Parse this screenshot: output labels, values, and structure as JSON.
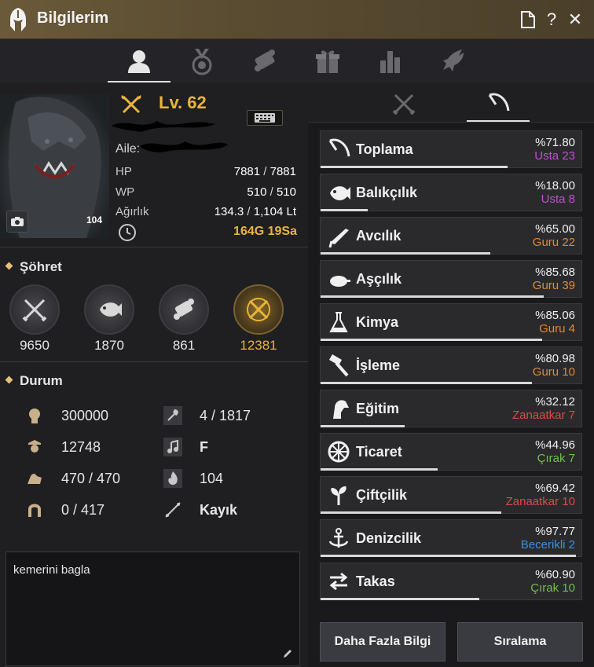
{
  "window": {
    "title": "Bilgilerim"
  },
  "titlebar_icons": [
    "document-icon",
    "help-icon",
    "close-icon"
  ],
  "main_tabs": [
    "profile-icon",
    "medal-icon",
    "scroll-icon",
    "gift-icon",
    "bar-chart-icon",
    "dragon-icon"
  ],
  "character": {
    "level_label": "Lv.",
    "level": "62",
    "aile_label": "Aile:",
    "portrait_badge": "104",
    "hp_label": "HP",
    "hp_cur": "7881",
    "hp_max": "7881",
    "wp_label": "WP",
    "wp_cur": "510",
    "wp_max": "510",
    "weight_label": "Ağırlık",
    "weight_cur": "134.3",
    "weight_max": "1,104 Lt",
    "time": "164G 19Sa"
  },
  "fame": {
    "title": "Şöhret",
    "items": [
      {
        "value": "9650",
        "icon": "crossed-swords-icon"
      },
      {
        "value": "1870",
        "icon": "fish-icon"
      },
      {
        "value": "861",
        "icon": "scroll-icon"
      },
      {
        "value": "12381",
        "icon": "crossed-swords-gold-icon"
      }
    ]
  },
  "durum": {
    "title": "Durum",
    "items": [
      {
        "icon": "knowledge-head-icon",
        "value": "300000"
      },
      {
        "icon": "axe-icon",
        "value": "4 / 1817"
      },
      {
        "icon": "officer-icon",
        "value": "12748"
      },
      {
        "icon": "music-note-icon",
        "value": "F"
      },
      {
        "icon": "strength-arm-icon",
        "value": "470 / 470"
      },
      {
        "icon": "flame-icon",
        "value": "104"
      },
      {
        "icon": "horseshoe-icon",
        "value": "0 / 417"
      },
      {
        "icon": "boat-icon",
        "value": "Kayık"
      }
    ]
  },
  "chat": {
    "text": "kemerini bagla"
  },
  "skills": [
    {
      "name": "Toplama",
      "pct": "%71.80",
      "rank": "Usta",
      "level": "23",
      "rank_color": "#c04fd0",
      "progress": 0.718,
      "icon": "sickle-icon"
    },
    {
      "name": "Balıkçılık",
      "pct": "%18.00",
      "rank": "Usta",
      "level": "8",
      "rank_color": "#c04fd0",
      "progress": 0.18,
      "icon": "fish-icon"
    },
    {
      "name": "Avcılık",
      "pct": "%65.00",
      "rank": "Guru",
      "level": "22",
      "rank_color": "#e08a35",
      "progress": 0.65,
      "icon": "rifle-icon"
    },
    {
      "name": "Aşçılık",
      "pct": "%85.68",
      "rank": "Guru",
      "level": "39",
      "rank_color": "#e08a35",
      "progress": 0.8568,
      "icon": "cooking-icon"
    },
    {
      "name": "Kimya",
      "pct": "%85.06",
      "rank": "Guru",
      "level": "4",
      "rank_color": "#e08a35",
      "progress": 0.8506,
      "icon": "flask-icon"
    },
    {
      "name": "İşleme",
      "pct": "%80.98",
      "rank": "Guru",
      "level": "10",
      "rank_color": "#e08a35",
      "progress": 0.8098,
      "icon": "hammer-icon"
    },
    {
      "name": "Eğitim",
      "pct": "%32.12",
      "rank": "Zanaatkar",
      "level": "7",
      "rank_color": "#e04848",
      "progress": 0.3212,
      "icon": "horse-head-icon"
    },
    {
      "name": "Ticaret",
      "pct": "%44.96",
      "rank": "Çırak",
      "level": "7",
      "rank_color": "#6fc04a",
      "progress": 0.4496,
      "icon": "wheel-icon"
    },
    {
      "name": "Çiftçilik",
      "pct": "%69.42",
      "rank": "Zanaatkar",
      "level": "10",
      "rank_color": "#e04848",
      "progress": 0.6942,
      "icon": "sprout-icon"
    },
    {
      "name": "Denizcilik",
      "pct": "%97.77",
      "rank": "Becerikli",
      "level": "2",
      "rank_color": "#3f8fe0",
      "progress": 0.9777,
      "icon": "anchor-icon"
    },
    {
      "name": "Takas",
      "pct": "%60.90",
      "rank": "Çırak",
      "level": "10",
      "rank_color": "#6fc04a",
      "progress": 0.609,
      "icon": "swap-arrows-icon"
    }
  ],
  "buttons": {
    "more_info": "Daha Fazla Bilgi",
    "ranking": "Sıralama"
  },
  "colors": {
    "gold": "#e8b53a",
    "titlebar": "#6a5a3a"
  }
}
